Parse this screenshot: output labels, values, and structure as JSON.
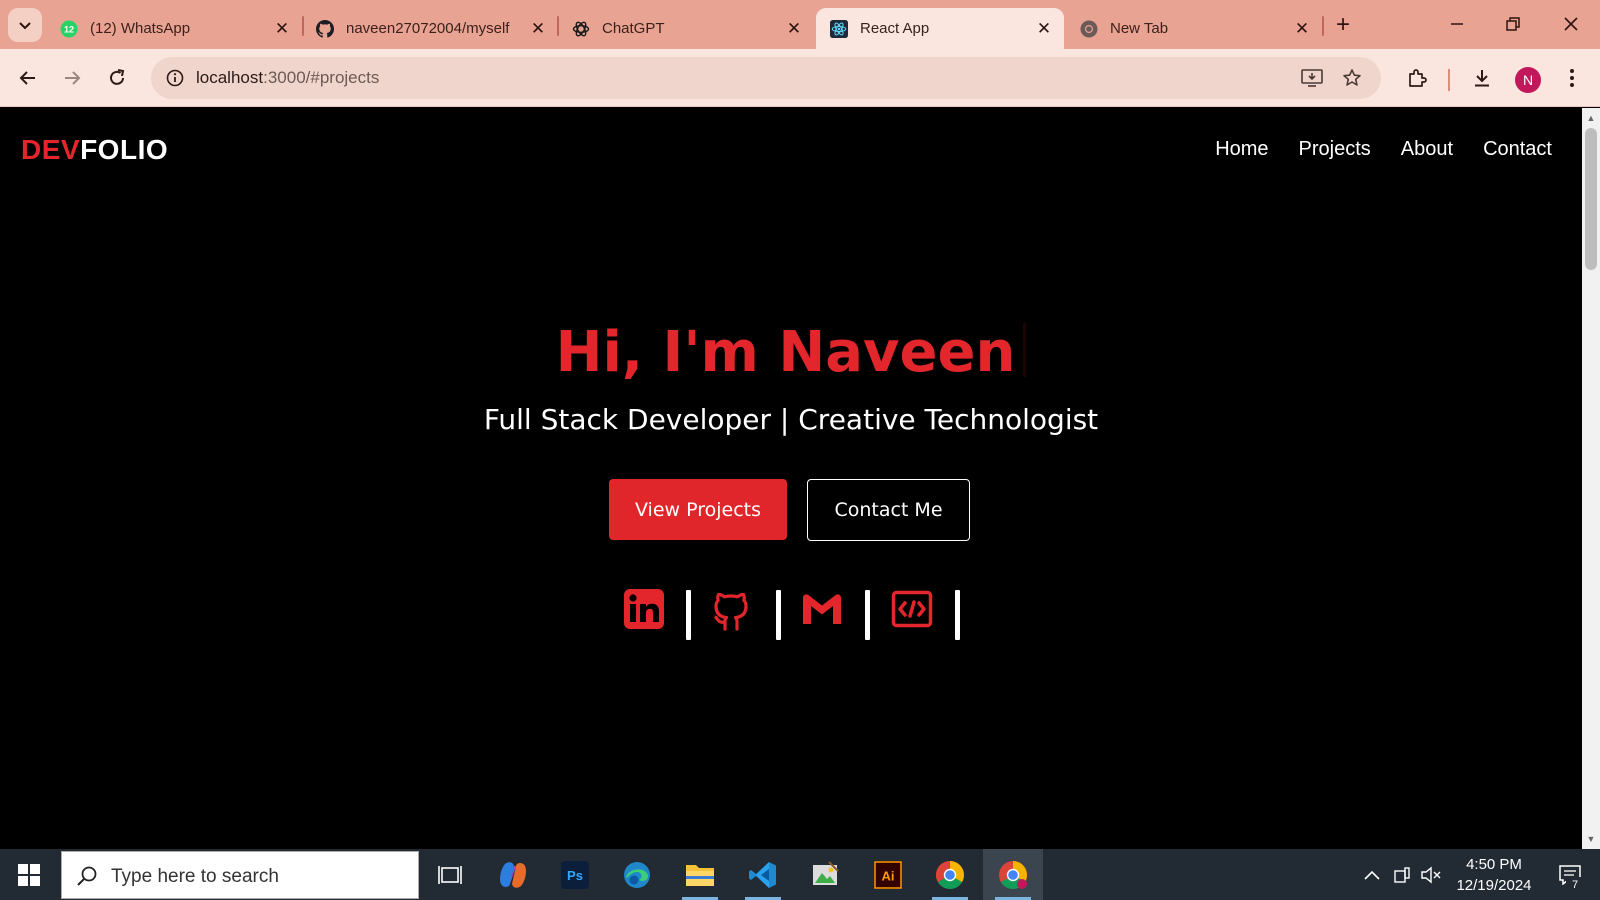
{
  "browser": {
    "tabs": [
      {
        "title": "(12) WhatsApp",
        "icon": "whatsapp-icon",
        "badge": "12",
        "active": false
      },
      {
        "title": "naveen27072004/myself",
        "icon": "github-icon",
        "active": false
      },
      {
        "title": "ChatGPT",
        "icon": "chatgpt-icon",
        "active": false
      },
      {
        "title": "React App",
        "icon": "react-icon",
        "active": true
      },
      {
        "title": "New Tab",
        "icon": "chrome-icon",
        "active": false
      }
    ],
    "address": {
      "host": "localhost",
      "path": ":3000/#projects"
    },
    "profile_initial": "N"
  },
  "page": {
    "logo": {
      "part1": "DEV",
      "part2": "FOLIO"
    },
    "nav": [
      "Home",
      "Projects",
      "About",
      "Contact"
    ],
    "hero": {
      "title": "Hi, I'm Naveen",
      "subtitle": "Full Stack Developer | Creative Technologist"
    },
    "buttons": {
      "primary": "View Projects",
      "secondary": "Contact Me"
    },
    "social_icons": [
      "linkedin-icon",
      "github-icon",
      "gmail-icon",
      "code-icon"
    ],
    "accent_color": "#e3262b"
  },
  "taskbar": {
    "search_placeholder": "Type here to search",
    "apps": [
      "task-view-icon",
      "copilot-icon",
      "photoshop-icon",
      "edge-icon",
      "file-explorer-icon",
      "vscode-icon",
      "image-viewer-icon",
      "illustrator-icon",
      "chrome-icon",
      "chrome-profile-icon"
    ],
    "time": "4:50 PM",
    "date": "12/19/2024",
    "notification_count": "7"
  }
}
